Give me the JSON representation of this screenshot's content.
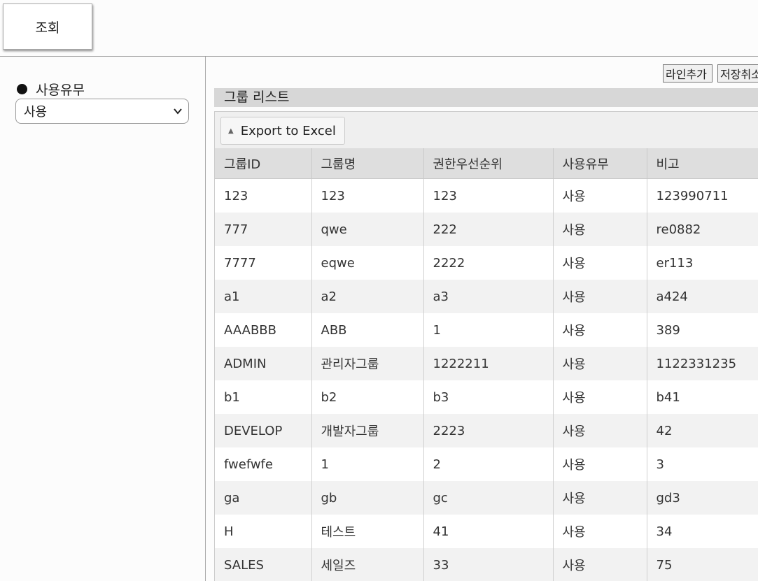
{
  "toolbar": {
    "search_label": "조회"
  },
  "filter": {
    "label": "사용유무",
    "selected": "사용"
  },
  "actions": {
    "add_line": "라인추가",
    "cancel_save": "저장취소"
  },
  "list": {
    "title": "그룹 리스트",
    "export_label": "Export to Excel",
    "columns": [
      "그룹ID",
      "그룹명",
      "권한우선순위",
      "사용유무",
      "비고"
    ],
    "rows": [
      [
        "123",
        "123",
        "123",
        "사용",
        "123990711"
      ],
      [
        "777",
        "qwe",
        "222",
        "사용",
        "re0882"
      ],
      [
        "7777",
        "eqwe",
        "2222",
        "사용",
        "er113"
      ],
      [
        "a1",
        "a2",
        "a3",
        "사용",
        "a424"
      ],
      [
        "AAABBB",
        "ABB",
        "1",
        "사용",
        "389"
      ],
      [
        "ADMIN",
        "관리자그룹",
        "1222211",
        "사용",
        "1122331235"
      ],
      [
        "b1",
        "b2",
        "b3",
        "사용",
        "b41"
      ],
      [
        "DEVELOP",
        "개발자그룹",
        "2223",
        "사용",
        "42"
      ],
      [
        "fwefwfe",
        "1",
        "2",
        "사용",
        "3"
      ],
      [
        "ga",
        "gb",
        "gc",
        "사용",
        "gd3"
      ],
      [
        "H",
        "테스트",
        "41",
        "사용",
        "34"
      ],
      [
        "SALES",
        "세일즈",
        "33",
        "사용",
        "75"
      ]
    ]
  }
}
